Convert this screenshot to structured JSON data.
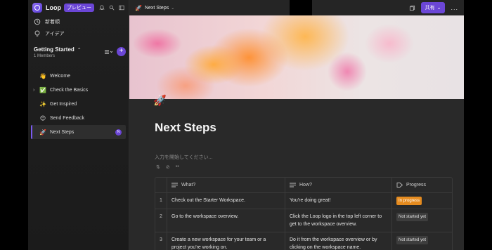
{
  "sidebar": {
    "app_name": "Loop",
    "preview_badge": "プレビュー",
    "nav": [
      {
        "label": "新着順",
        "icon": "clock-icon"
      },
      {
        "label": "アイデア",
        "icon": "lightbulb-icon"
      }
    ],
    "workspace": {
      "name": "Getting Started",
      "members": "1 Members"
    },
    "pages": [
      {
        "emoji": "👋",
        "label": "Welcome"
      },
      {
        "emoji": "✅",
        "label": "Check the Basics"
      },
      {
        "emoji": "✨",
        "label": "Get Inspired"
      },
      {
        "emoji": "😊",
        "label": "Send Feedback"
      },
      {
        "emoji": "🚀",
        "label": "Next Steps"
      }
    ],
    "active_avatar": "N"
  },
  "topbar": {
    "breadcrumb_emoji": "🚀",
    "breadcrumb": "Next Steps",
    "share_label": "共有",
    "more": "..."
  },
  "page": {
    "emoji": "🚀",
    "title": "Next Steps",
    "placeholder": "入力を開始してください..."
  },
  "table": {
    "headers": [
      "What?",
      "How?",
      "Progress"
    ],
    "rows": [
      {
        "num": "1",
        "what": "Check out the Starter Workspace.",
        "how": "You're doing great!",
        "progress": "In progress",
        "status": "progress"
      },
      {
        "num": "2",
        "what": "Go to the workspace overview.",
        "how": "Click the Loop logo in the top left corner to get to the workspace overview.",
        "progress": "Not started yet",
        "status": "notstarted"
      },
      {
        "num": "3",
        "what": "Create a new workspace for your team or a project you're working on.",
        "how": "Do it from the workspace overview or by clicking on the workspace name.",
        "progress": "Not started yet",
        "status": "notstarted"
      }
    ]
  },
  "colors": {
    "accent": "#6b46d6",
    "in_progress": "#e58b1f"
  }
}
